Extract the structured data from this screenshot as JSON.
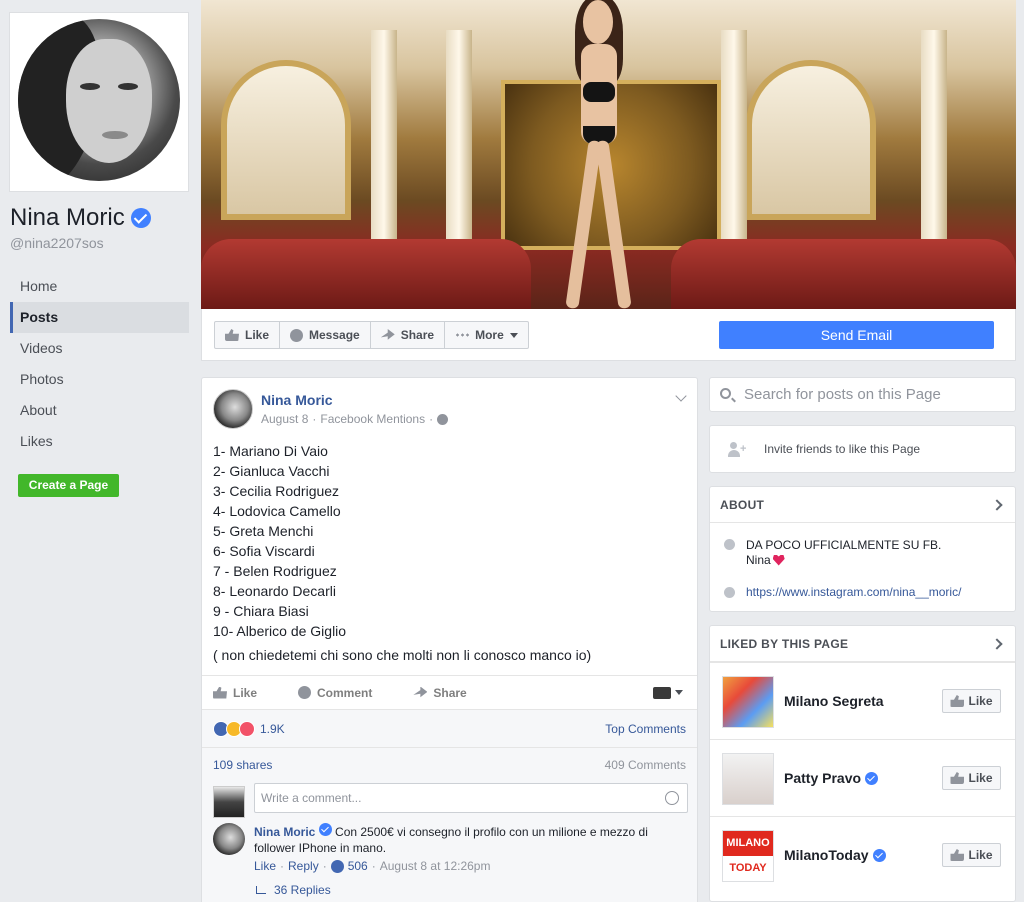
{
  "profile": {
    "name": "Nina Moric",
    "handle": "@nina2207sos"
  },
  "nav": {
    "items": [
      {
        "label": "Home",
        "active": false
      },
      {
        "label": "Posts",
        "active": true
      },
      {
        "label": "Videos",
        "active": false
      },
      {
        "label": "Photos",
        "active": false
      },
      {
        "label": "About",
        "active": false
      },
      {
        "label": "Likes",
        "active": false
      }
    ],
    "create_page": "Create a Page"
  },
  "action_bar": {
    "like": "Like",
    "message": "Message",
    "share": "Share",
    "more": "More",
    "send_email": "Send Email"
  },
  "post": {
    "author": "Nina Moric",
    "date": "August 8",
    "source": "Facebook Mentions",
    "list": [
      "1- Mariano Di Vaio",
      "2- Gianluca Vacchi",
      "3- Cecilia Rodriguez",
      "4- Lodovica Camello",
      "5- Greta Menchi",
      "6- Sofia Viscardi",
      "7 - Belen Rodriguez",
      "8- Leonardo Decarli",
      "9 - Chiara Biasi",
      "10- Alberico de Giglio"
    ],
    "note": "( non chiedetemi chi sono che molti non li conosco manco io)",
    "actions": {
      "like": "Like",
      "comment": "Comment",
      "share": "Share"
    },
    "reactions_count": "1.9K",
    "top_comments": "Top Comments",
    "shares": "109 shares",
    "comments_count": "409 Comments",
    "comment_placeholder": "Write a comment...",
    "comment": {
      "author": "Nina Moric",
      "text": "Con 2500€ vi consegno il profilo con un milione e mezzo di follower IPhone in mano.",
      "like": "Like",
      "reply": "Reply",
      "likes": "506",
      "time": "August 8 at 12:26pm",
      "replies": "36 Replies"
    }
  },
  "sidebar": {
    "search_placeholder": "Search for posts on this Page",
    "invite": "Invite friends to like this Page",
    "about": {
      "title": "ABOUT",
      "line1": "DA POCO UFFICIALMENTE SU FB.",
      "line2": "Nina",
      "link": "https://www.instagram.com/nina__moric/"
    },
    "liked": {
      "title": "LIKED BY THIS PAGE",
      "items": [
        {
          "name": "Milano Segreta",
          "verified": false,
          "like": "Like"
        },
        {
          "name": "Patty Pravo",
          "verified": true,
          "like": "Like"
        },
        {
          "name": "MilanoToday",
          "verified": true,
          "like": "Like",
          "logo_top": "MILANO",
          "logo_bottom": "TODAY"
        }
      ]
    }
  },
  "colors": {
    "brand_blue": "#4267b2",
    "link_blue": "#365899",
    "send_email_blue": "#4080ff",
    "create_page_green": "#42b72a",
    "background": "#e9ebee"
  },
  "icons": [
    "verified-badge-icon",
    "thumb-like-icon",
    "message-icon",
    "share-icon",
    "more-dots-icon",
    "globe-icon",
    "search-icon",
    "add-friend-icon",
    "info-icon",
    "heart-icon",
    "chevron-right-icon",
    "smiley-icon",
    "reply-arrow-icon"
  ]
}
